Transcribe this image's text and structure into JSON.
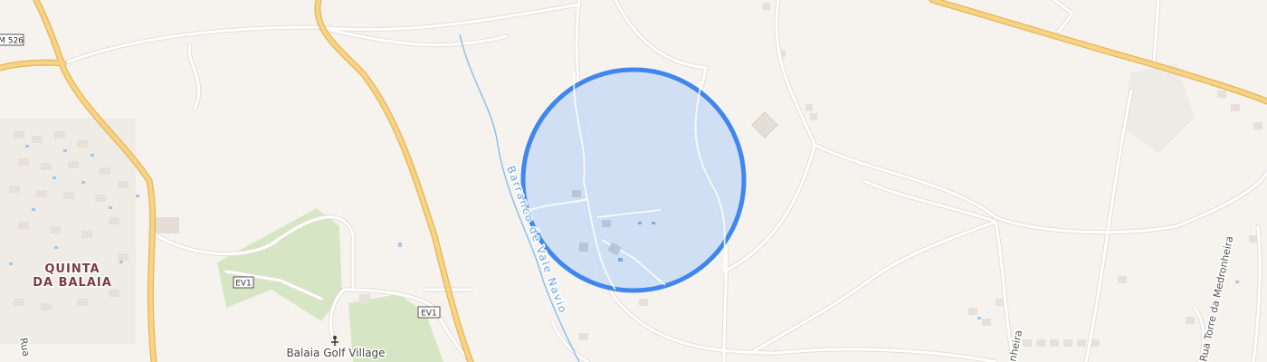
{
  "map": {
    "place_label_line1": "QUINTA",
    "place_label_line2": "DA BALAIA",
    "poi_label": "Balaia Golf Village",
    "road_shields": [
      "M 526",
      "EV1",
      "EV1"
    ],
    "waterway_label": "Barranco de Vale Navio",
    "street_labels": [
      "Rua Torre da Medronheira",
      "Rua",
      "nheira"
    ],
    "colors": {
      "background": "#f6f3ef",
      "major_road": "#f5cf7a",
      "minor_road": "#ffffff",
      "water": "#8cc0ea",
      "park": "#d6e6c4",
      "radius_fill": "#c9daf3",
      "radius_stroke": "#3f86ee",
      "place_label": "#7a3b43"
    },
    "overlay": "radius-circle"
  }
}
